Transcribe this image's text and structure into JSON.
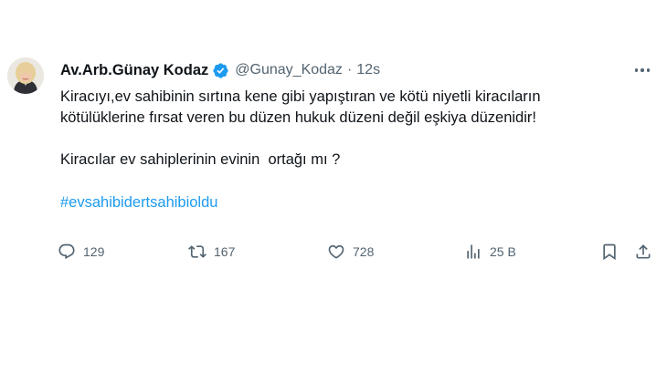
{
  "author": {
    "name": "Av.Arb.Günay Kodaz",
    "handle": "@Gunay_Kodaz",
    "separator": "·",
    "time": "12s"
  },
  "tweet": {
    "lines": [
      "Kiracıyı,ev sahibinin sırtına kene gibi yapıştıran ve kötü niyetli kiracıların",
      "kötülüklerine fırsat veren bu düzen hukuk düzeni değil eşkiya düzenidir!",
      "Kiracılar ev sahiplerinin evinin  ortağı mı ?"
    ],
    "hashtag": "#evsahibidertsahibioldu"
  },
  "actions": {
    "replies": "129",
    "retweets": "167",
    "likes": "728",
    "views": "25 B"
  },
  "icons": {
    "verified": "verified-badge-icon",
    "more": "more-options-icon",
    "reply": "reply-icon",
    "retweet": "retweet-icon",
    "like": "heart-icon",
    "views": "views-chart-icon",
    "bookmark": "bookmark-icon",
    "share": "share-icon"
  },
  "colors": {
    "text": "#0f1419",
    "secondary": "#536471",
    "accent": "#1d9bf0"
  }
}
